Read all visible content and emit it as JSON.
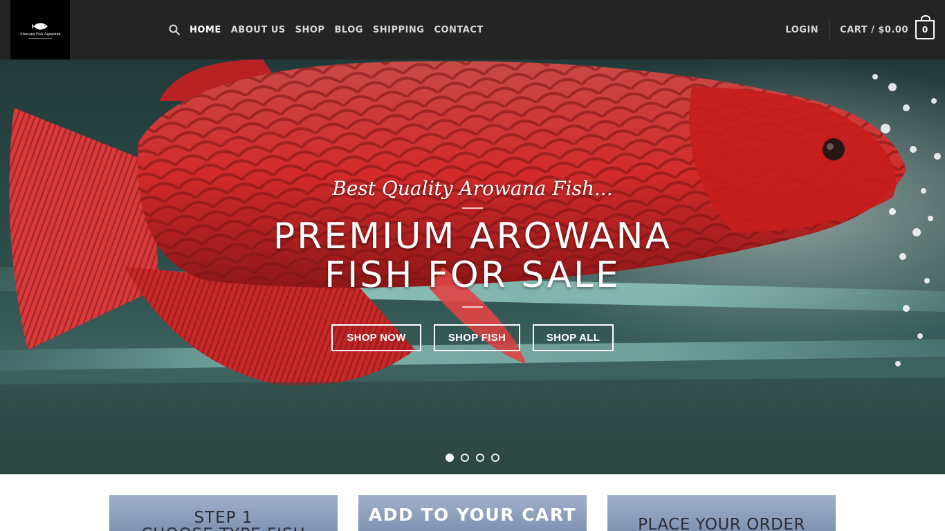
{
  "header": {
    "logo": {
      "text": "Arowana Fish Aquarium",
      "icon": "fish-logo-icon"
    },
    "nav": {
      "search_icon": "search-icon",
      "items": [
        {
          "label": "HOME",
          "active": true
        },
        {
          "label": "ABOUT US",
          "active": false
        },
        {
          "label": "SHOP",
          "active": false
        },
        {
          "label": "BLOG",
          "active": false
        },
        {
          "label": "SHIPPING",
          "active": false
        },
        {
          "label": "CONTACT",
          "active": false
        }
      ]
    },
    "account": {
      "login_label": "LOGIN",
      "cart_label": "CART / $0.00",
      "cart_count": "0"
    }
  },
  "hero": {
    "script_text": "Best Quality Arowana Fish...",
    "title_line1": "PREMIUM AROWANA",
    "title_line2": "FISH FOR SALE",
    "buttons": [
      {
        "label": "SHOP NOW"
      },
      {
        "label": "SHOP FISH"
      },
      {
        "label": "SHOP ALL"
      }
    ],
    "slides": {
      "count": 4,
      "active_index": 0
    }
  },
  "steps": {
    "step1": {
      "line1": "STEP 1",
      "line2": "CHOOSE TYPE FISH"
    },
    "step2": {
      "line1": "ADD TO YOUR CART"
    },
    "step3": {
      "line1": "PLACE YOUR ORDER"
    }
  },
  "colors": {
    "header_bg": "#242424",
    "nav_text": "#d6d6d6",
    "step_card_bg": "#8fa2be"
  }
}
